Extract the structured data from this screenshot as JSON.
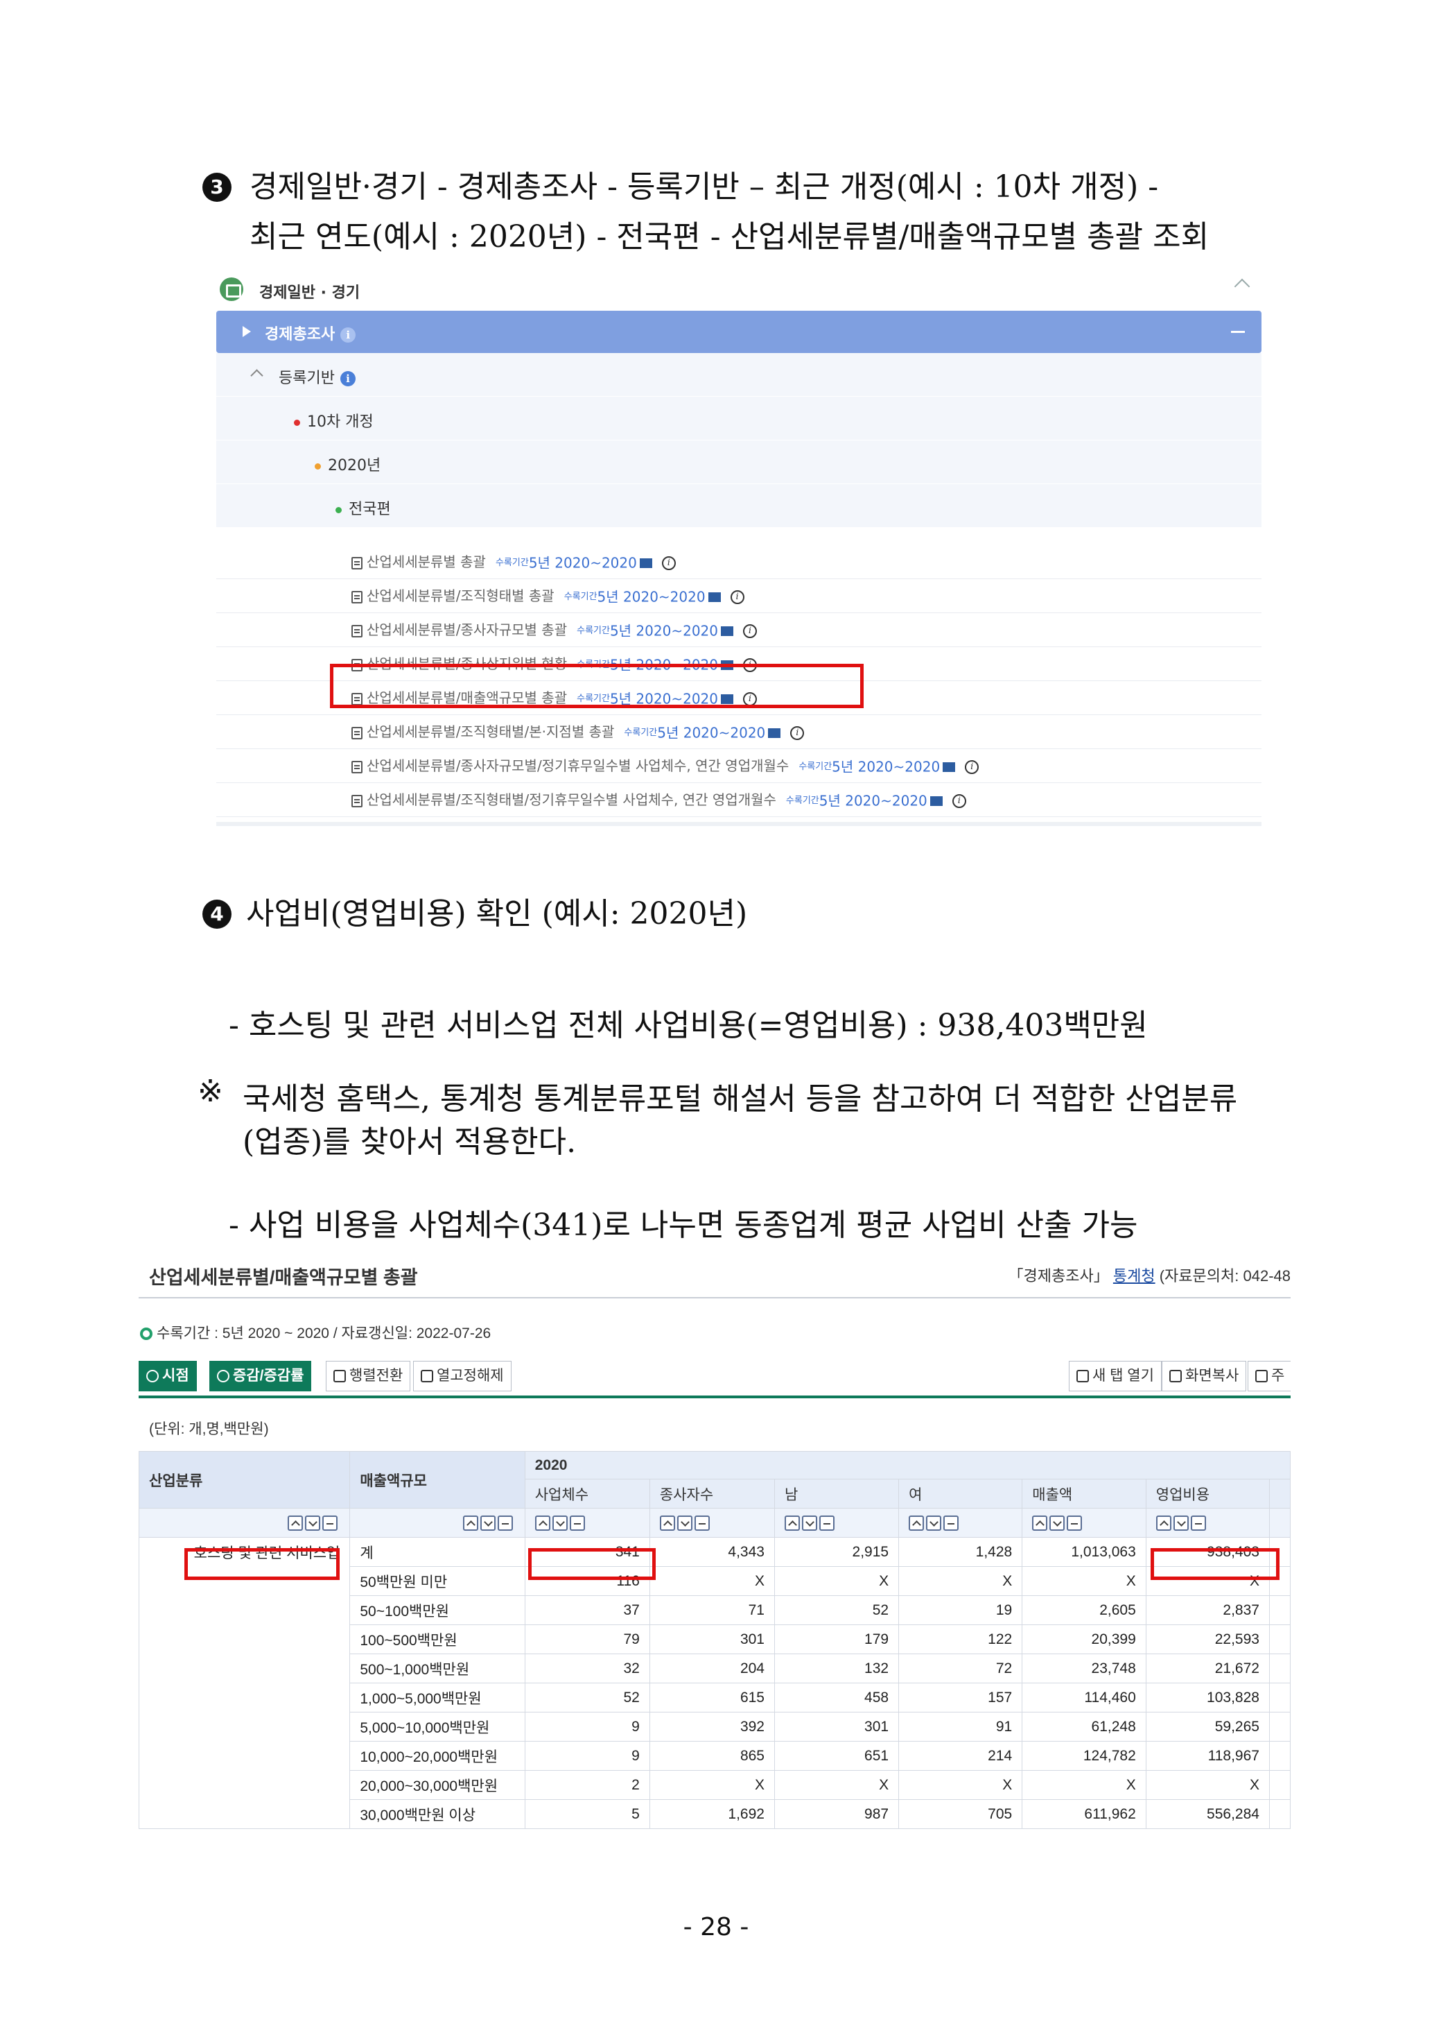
{
  "step3": {
    "num": "3",
    "line1": "경제일반·경기 - 경제총조사 - 등록기반 – 최근 개정(예시 : 10차 개정) -",
    "line2": "최근 연도(예시 : 2020년) - 전국편 - 산업세분류별/매출액규모별 총괄 조회"
  },
  "tree": {
    "category": "경제일반 · 경기",
    "survey": "경제총조사",
    "basis": "등록기반",
    "revision": "10차 개정",
    "year": "2020년",
    "edition": "전국편",
    "dot_colors": {
      "revision": "#e03030",
      "year": "#f0a030",
      "edition": "#3cb050"
    },
    "items": [
      {
        "label": "산업세세분류별 총괄",
        "badge": "수록기간",
        "range": "5년 2020~2020"
      },
      {
        "label": "산업세세분류별/조직형태별 총괄",
        "badge": "수록기간",
        "range": "5년 2020~2020"
      },
      {
        "label": "산업세세분류별/종사자규모별 총괄",
        "badge": "수록기간",
        "range": "5년 2020~2020"
      },
      {
        "label": "산업세세분류별/종사상지위별 현황",
        "badge": "수록기간",
        "range": "5년 2020~2020"
      },
      {
        "label": "산업세세분류별/매출액규모별 총괄",
        "badge": "수록기간",
        "range": "5년 2020~2020"
      },
      {
        "label": "산업세세분류별/조직형태별/본·지점별 총괄",
        "badge": "수록기간",
        "range": "5년 2020~2020"
      },
      {
        "label": "산업세세분류별/종사자규모별/정기휴무일수별 사업체수, 연간 영업개월수",
        "badge": "수록기간",
        "range": "5년 2020~2020"
      },
      {
        "label": "산업세세분류별/조직형태별/정기휴무일수별 사업체수, 연간 영업개월수",
        "badge": "수록기간",
        "range": "5년 2020~2020"
      }
    ]
  },
  "step4": {
    "num": "4",
    "title": "사업비(영업비용) 확인 (예시: 2020년)"
  },
  "para1": "- 호스팅 및 관련 서비스업 전체 사업비용(=영업비용) : 938,403백만원",
  "note": {
    "mark": "※",
    "line1": "국세청 홈택스, 통계청 통계분류포털 해설서 등을 참고하여 더 적합한 산업분류",
    "line2": "(업종)를 찾아서 적용한다."
  },
  "para2": "- 사업 비용을 사업체수(341)로 나누면 동종업계 평균 사업비 산출 가능",
  "table_view": {
    "title": "산업세세분류별/매출액규모별 총괄",
    "source_prefix": "「경제총조사」",
    "source_link": "통계청",
    "source_suffix": "(자료문의처: 042-48",
    "meta": "수록기간 : 5년 2020 ~ 2020 / 자료갱신일: 2022-07-26",
    "buttons": {
      "time": "시점",
      "rate": "증감/증감률",
      "pivot": "행렬전환",
      "unfix": "열고정해제",
      "new_tab": "새 탭 열기",
      "copy": "화면복사",
      "more": "주"
    },
    "unit": "(단위: 개,명,백만원)",
    "col_industry": "산업분류",
    "col_scale": "매출액규모",
    "year": "2020",
    "columns": [
      "사업체수",
      "종사자수",
      "남",
      "여",
      "매출액",
      "영업비용"
    ],
    "industry": "호스팅 및 관련 서비스업",
    "rows": [
      {
        "scale": "계",
        "v": [
          "341",
          "4,343",
          "2,915",
          "1,428",
          "1,013,063",
          "938,403"
        ]
      },
      {
        "scale": "50백만원 미만",
        "v": [
          "116",
          "X",
          "X",
          "X",
          "X",
          "X"
        ]
      },
      {
        "scale": "50~100백만원",
        "v": [
          "37",
          "71",
          "52",
          "19",
          "2,605",
          "2,837"
        ]
      },
      {
        "scale": "100~500백만원",
        "v": [
          "79",
          "301",
          "179",
          "122",
          "20,399",
          "22,593"
        ]
      },
      {
        "scale": "500~1,000백만원",
        "v": [
          "32",
          "204",
          "132",
          "72",
          "23,748",
          "21,672"
        ]
      },
      {
        "scale": "1,000~5,000백만원",
        "v": [
          "52",
          "615",
          "458",
          "157",
          "114,460",
          "103,828"
        ]
      },
      {
        "scale": "5,000~10,000백만원",
        "v": [
          "9",
          "392",
          "301",
          "91",
          "61,248",
          "59,265"
        ]
      },
      {
        "scale": "10,000~20,000백만원",
        "v": [
          "9",
          "865",
          "651",
          "214",
          "124,782",
          "118,967"
        ]
      },
      {
        "scale": "20,000~30,000백만원",
        "v": [
          "2",
          "X",
          "X",
          "X",
          "X",
          "X"
        ]
      },
      {
        "scale": "30,000백만원 이상",
        "v": [
          "5",
          "1,692",
          "987",
          "705",
          "611,962",
          "556,284"
        ]
      }
    ]
  },
  "page_number": "- 28 -"
}
